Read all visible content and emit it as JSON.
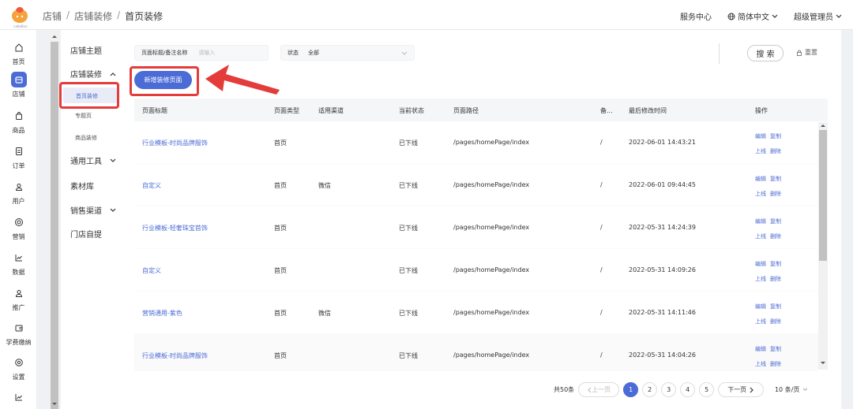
{
  "brand": {
    "logo_text": "LeKeBoo",
    "logo_color": "#ee5a3a"
  },
  "breadcrumb": [
    "店铺",
    "店铺装修",
    "首页装修"
  ],
  "header": {
    "service": "服务中心",
    "language": "简体中文",
    "user": "超级管理员"
  },
  "rail": [
    {
      "label": "首页",
      "icon": "home-icon"
    },
    {
      "label": "店铺",
      "icon": "store-icon",
      "active": true
    },
    {
      "label": "商品",
      "icon": "bag-icon"
    },
    {
      "label": "订单",
      "icon": "order-icon"
    },
    {
      "label": "用户",
      "icon": "user-icon"
    },
    {
      "label": "营销",
      "icon": "target-icon"
    },
    {
      "label": "数据",
      "icon": "chart-icon"
    },
    {
      "label": "推广",
      "icon": "person-icon"
    },
    {
      "label": "学费缴纳",
      "icon": "wallet-icon"
    },
    {
      "label": "设置",
      "icon": "settings-icon"
    },
    {
      "label": "",
      "icon": "chart-icon"
    }
  ],
  "submenu": {
    "theme": "店铺主题",
    "decoration": "店铺装修",
    "decoration_children": [
      "首页装修",
      "专题页",
      "商品装修"
    ],
    "tools": "通用工具",
    "materials": "素材库",
    "channels": "销售渠道",
    "pickup": "门店自提"
  },
  "filters": {
    "title_label": "页面标题/备注名称",
    "title_placeholder": "请输入",
    "status_label": "状态",
    "status_value": "全部",
    "search": "搜 索",
    "reset": "重置"
  },
  "add_button": "新增装修页面",
  "table": {
    "headers": [
      "页面标题",
      "页面类型",
      "适用渠道",
      "当前状态",
      "页面路径",
      "备...",
      "最后修改时间",
      "操作"
    ],
    "rows": [
      {
        "title": "行业模板-时尚品牌服饰",
        "type": "首页",
        "channel": "",
        "status": "已下线",
        "path": "/pages/homePage/index",
        "note": "/",
        "time": "2022-06-01 14:43:21"
      },
      {
        "title": "自定义",
        "type": "首页",
        "channel": "微信",
        "status": "已下线",
        "path": "/pages/homePage/index",
        "note": "/",
        "time": "2022-06-01 09:44:45"
      },
      {
        "title": "行业模板-轻奢珠宝首饰",
        "type": "首页",
        "channel": "",
        "status": "已下线",
        "path": "/pages/homePage/index",
        "note": "/",
        "time": "2022-05-31 14:24:39"
      },
      {
        "title": "自定义",
        "type": "首页",
        "channel": "",
        "status": "已下线",
        "path": "/pages/homePage/index",
        "note": "/",
        "time": "2022-05-31 14:09:26"
      },
      {
        "title": "营销通用-紫色",
        "type": "首页",
        "channel": "微信",
        "status": "已下线",
        "path": "/pages/homePage/index",
        "note": "/",
        "time": "2022-05-31 14:11:46"
      },
      {
        "title": "行业模板-时尚品牌服饰",
        "type": "首页",
        "channel": "",
        "status": "已下线",
        "path": "/pages/homePage/index",
        "note": "/",
        "time": "2022-05-31 14:04:26"
      }
    ],
    "ops": [
      "编辑",
      "复制",
      "上线",
      "删除"
    ]
  },
  "pagination": {
    "total": "共50条",
    "prev": "上一页",
    "next": "下一页",
    "pages": [
      "1",
      "2",
      "3",
      "4",
      "5"
    ],
    "current": "1",
    "page_size": "10 条/页"
  },
  "accent": "#4b6bd6"
}
